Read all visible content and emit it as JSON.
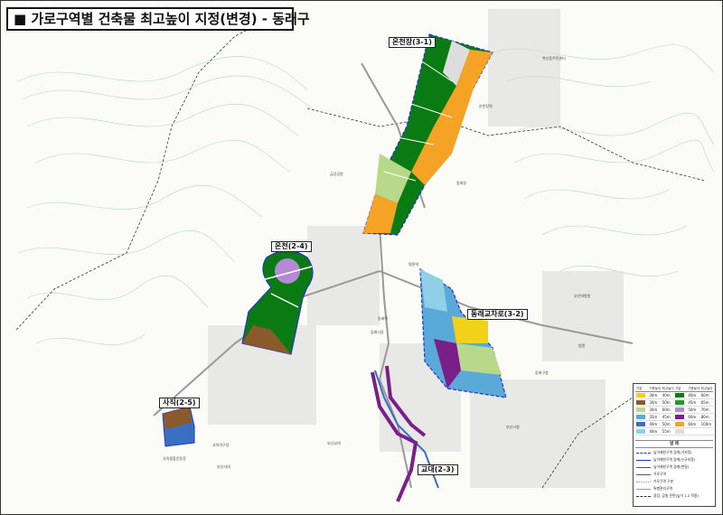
{
  "title": "■ 가로구역별 건축물 최고높이 지정(변경) - 동래구",
  "zones": [
    {
      "id": "oncheonjang",
      "label": "온천장(3-1)"
    },
    {
      "id": "oncheon",
      "label": "온천(2-4)"
    },
    {
      "id": "dongnae",
      "label": "동래교차로(3-2)"
    },
    {
      "id": "sajik",
      "label": "사직(2-5)"
    },
    {
      "id": "gyodae",
      "label": "교대(2-3)"
    }
  ],
  "places": [
    "부산교대",
    "동래역",
    "부산시청",
    "사직종합운동장",
    "부산사대",
    "동래구청",
    "명륜역",
    "온천장역",
    "금강공원",
    "동래시장",
    "사직야구장",
    "법원",
    "동래성",
    "부산대병원",
    "복산동주민센터"
  ],
  "legend": {
    "header": [
      "구분",
      "기준높이",
      "최고높이"
    ],
    "rows": [
      {
        "left": {
          "color": "#f2d11b",
          "base": "30m",
          "max": "40m"
        },
        "right": {
          "color": "#0a7a12",
          "base": "40m",
          "max": "60m"
        }
      },
      {
        "left": {
          "color": "#8b5a2b",
          "base": "30m",
          "max": "50m"
        },
        "right": {
          "color": "#1f9a2a",
          "base": "45m",
          "max": "65m"
        }
      },
      {
        "left": {
          "color": "#b8d98a",
          "base": "30m",
          "max": "60m"
        },
        "right": {
          "color": "#b48ad6",
          "base": "50m",
          "max": "70m"
        }
      },
      {
        "left": {
          "color": "#5aa9d8",
          "base": "35m",
          "max": "45m"
        },
        "right": {
          "color": "#7a1f8a",
          "base": "60m",
          "max": "80m"
        }
      },
      {
        "left": {
          "color": "#3b6fc4",
          "base": "40m",
          "max": "50m"
        },
        "right": {
          "color": "#f5a324",
          "base": "60m",
          "max": "100m"
        }
      },
      {
        "left": {
          "color": "#8fd0e6",
          "base": "40m",
          "max": "55m"
        },
        "right": {
          "color": "#dddddd",
          "base": "",
          "max": ""
        }
      }
    ],
    "section_title": "범  례",
    "lines": [
      {
        "label": "높이제한구역 경계(기지정)",
        "color": "#2233cc",
        "style": "dashed"
      },
      {
        "label": "높이제한구역 경계(신규지정)",
        "color": "#2233cc",
        "style": "solid"
      },
      {
        "label": "높이제한구역 경계(변경)",
        "color": "#6633aa",
        "style": "solid"
      },
      {
        "label": "가로구역",
        "color": "#555555",
        "style": "solid"
      },
      {
        "label": "가로구역 구분",
        "color": "#999999",
        "style": "dotted"
      },
      {
        "label": "특별관리구역",
        "color": "#999999",
        "style": "solid"
      },
      {
        "label": "광장, 공원 전면(높이 1.2 적용)",
        "color": "#333333",
        "style": "dashed"
      }
    ]
  },
  "colors": {
    "green": "#0a7a12",
    "light_green": "#b8d98a",
    "orange": "#f5a324",
    "brown": "#8b5a2b",
    "purple": "#7a1f8a",
    "lavender": "#b48ad6",
    "blue": "#3b6fc4",
    "light_blue": "#5aa9d8",
    "yellow": "#f2d11b",
    "boundary": "#2233cc",
    "contour": "#7fc28a"
  }
}
